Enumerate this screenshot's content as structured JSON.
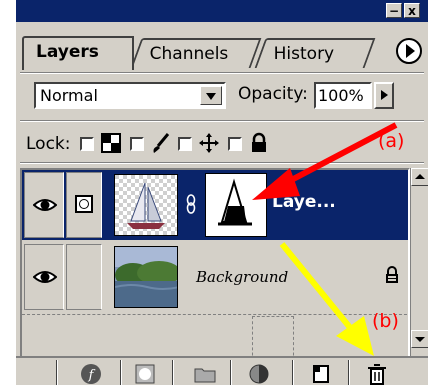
{
  "tabs": [
    {
      "label": "Layers",
      "active": true
    },
    {
      "label": "Channels",
      "active": false
    },
    {
      "label": "History",
      "active": false
    }
  ],
  "blend_mode": {
    "value": "Normal"
  },
  "opacity": {
    "label": "Opacity:",
    "value": "100%"
  },
  "lock": {
    "label": "Lock:"
  },
  "layers": [
    {
      "name": "Laye...",
      "selected": true,
      "visible": true
    },
    {
      "name": "Background",
      "selected": false,
      "visible": true,
      "locked": true
    }
  ],
  "annotations": {
    "a": {
      "label": "(a)",
      "color": "#ff0000"
    },
    "b": {
      "label": "(b)",
      "color": "#ff0000"
    },
    "arrow_a_color": "#ff0000",
    "arrow_b_color": "#ffff00"
  },
  "colors": {
    "panel_bg": "#d4d0c8",
    "selection": "#0a246a",
    "titlebar": "#0a246a"
  },
  "window_controls": {
    "minimize": "−",
    "close": "x"
  }
}
